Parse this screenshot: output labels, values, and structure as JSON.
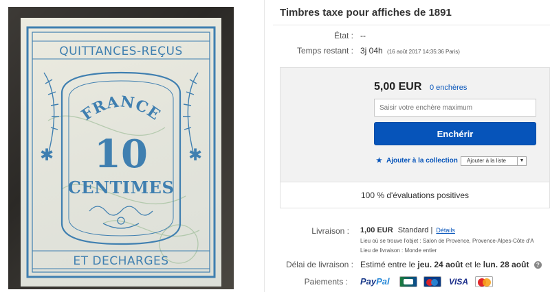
{
  "listing": {
    "title": "Timbres taxe pour affiches de 1891"
  },
  "stamp": {
    "top_text": "QUITTANCES-REÇUS",
    "country": "FRANCE",
    "value": "10",
    "unit": "CENTIMES",
    "bottom_text": "ET DECHARGES"
  },
  "details": {
    "state_label": "État :",
    "state_value": "--",
    "time_label": "Temps restant :",
    "time_value": "3j 04h",
    "time_detail": "(16 août 2017   14:35:36 Paris)"
  },
  "bidding": {
    "price": "5,00 EUR",
    "bid_count": "0 enchères",
    "input_placeholder": "Saisir votre enchère maximum",
    "bid_button": "Enchérir",
    "add_collection": "Ajouter à la collection",
    "watchlist_select": "Ajouter à la liste"
  },
  "feedback": {
    "text": "100 % d'évaluations positives"
  },
  "shipping": {
    "label": "Livraison :",
    "cost": "1,00 EUR",
    "service": "Standard |",
    "details_link": "Détails",
    "location": "Lieu où se trouve l'objet :  Salon de Provence, Provence-Alpes-Côte d'A",
    "ships_to": "Lieu de livraison :  Monde entier"
  },
  "delivery": {
    "label": "Délai de livraison :",
    "text_prefix": "Estimé entre le ",
    "date_from": "jeu. 24 août",
    "text_mid": " et le ",
    "date_to": "lun. 28 août"
  },
  "payment": {
    "label": "Paiements :",
    "paypal_a": "Pay",
    "paypal_b": "Pal",
    "visa": "VISA"
  },
  "colors": {
    "accent": "#0654ba",
    "stamp_ink": "#3f7fb0"
  }
}
